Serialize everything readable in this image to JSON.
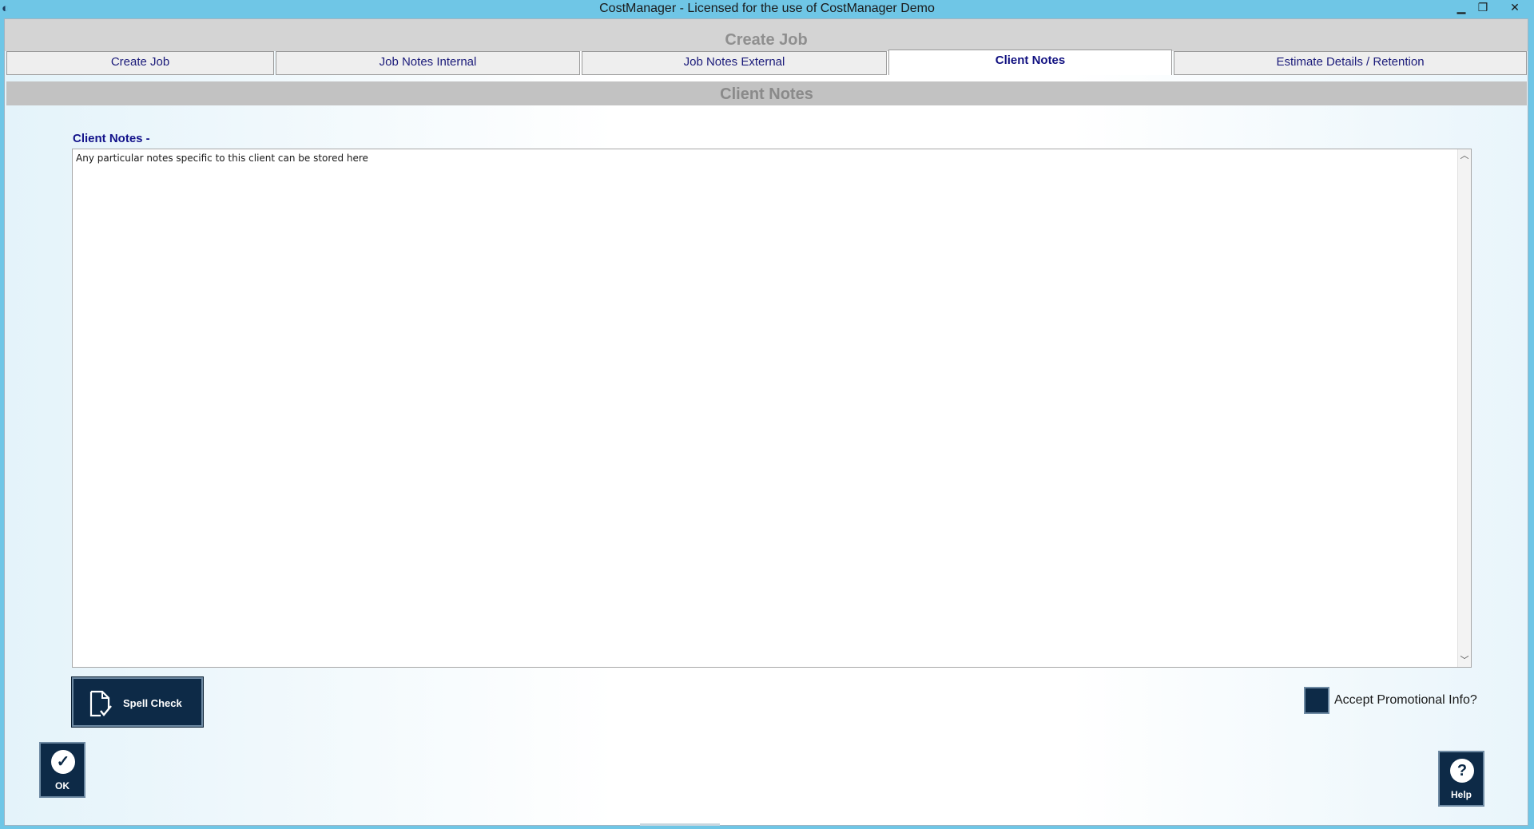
{
  "titlebar": {
    "title": "CostManager - Licensed for the use of CostManager Demo",
    "minimize_glyph": "▁",
    "maximize_glyph": "❐",
    "close_glyph": "✕",
    "app_icon_glyph": "◐"
  },
  "header": {
    "title": "Create Job"
  },
  "tabs": [
    {
      "label": "Create Job"
    },
    {
      "label": "Job Notes Internal"
    },
    {
      "label": "Job Notes External"
    },
    {
      "label": "Client Notes",
      "active": true
    },
    {
      "label": "Estimate Details / Retention"
    }
  ],
  "section": {
    "title": "Client Notes"
  },
  "notes": {
    "label": "Client Notes -",
    "value": "Any particular notes specific to this client can be stored here",
    "scroll_up_glyph": "︿",
    "scroll_down_glyph": "﹀"
  },
  "spell_check": {
    "label": "Spell Check",
    "icon": "document-check-icon"
  },
  "promo": {
    "label": "Accept Promotional Info?",
    "checked": false
  },
  "ok_button": {
    "label": "OK",
    "icon_glyph": "✓"
  },
  "help_button": {
    "label": "Help",
    "icon_glyph": "?"
  },
  "colors": {
    "titlebar": "#6fc6e6",
    "button_bg": "#0d2a47",
    "tab_text": "#1b1b7a",
    "header_text": "#8f8f8f"
  }
}
